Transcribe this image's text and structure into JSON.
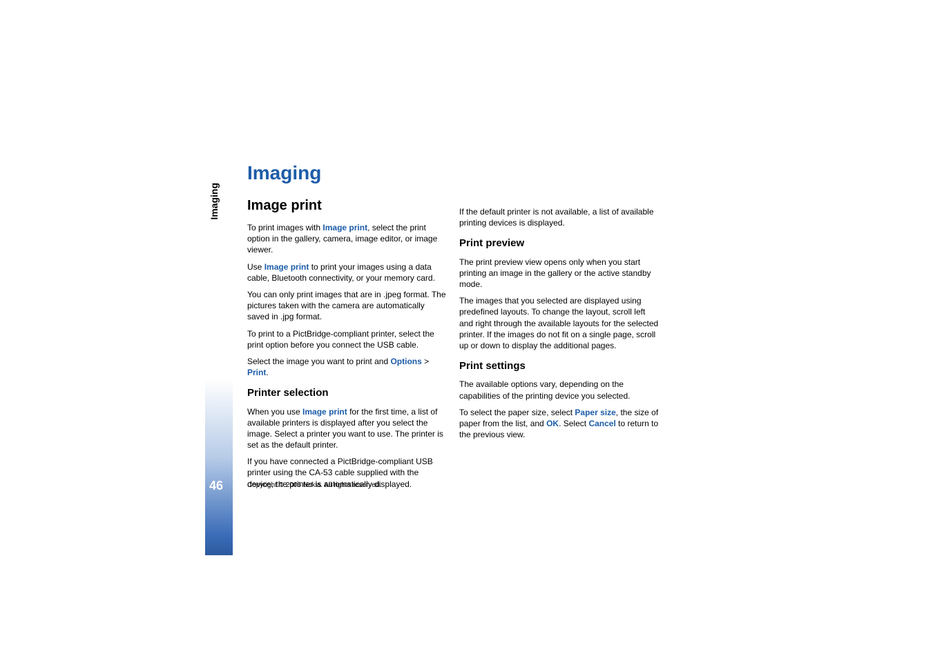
{
  "sidebar": {
    "label": "Imaging",
    "pageNumber": "46"
  },
  "mainTitle": "Imaging",
  "leftColumn": {
    "heading": "Image print",
    "p1_a": "To print images with ",
    "p1_link": "Image print",
    "p1_b": ", select the print option in the gallery, camera, image editor, or image viewer.",
    "p2_a": "Use ",
    "p2_link": "Image print",
    "p2_b": " to print your images using a data cable, Bluetooth connectivity, or your memory card.",
    "p3": "You can only print images that are in .jpeg format. The pictures taken with the camera are automatically saved in .jpg format.",
    "p4": "To print to a PictBridge-compliant printer, select the print option before you connect the USB cable.",
    "p5_a": "Select the image you want to print and ",
    "p5_link1": "Options",
    "p5_mid": " > ",
    "p5_link2": "Print",
    "p5_end": ".",
    "subheading": "Printer selection",
    "p6_a": "When you use ",
    "p6_link": "Image print",
    "p6_b": " for the first time, a list of available printers is displayed after you select the image. Select a printer you want to use. The printer is set as the default printer.",
    "p7": "If you have connected a PictBridge-compliant USB printer using the CA-53 cable supplied with the device, the printer is automatically displayed."
  },
  "rightColumn": {
    "p1": "If the default printer is not available, a list of available printing devices is displayed.",
    "subheading1": "Print preview",
    "p2": "The print preview view opens only when you start printing an image in the gallery or the active standby mode.",
    "p3": "The images that you selected are displayed using predefined layouts. To change the layout, scroll left and right through the available layouts for the selected printer. If the images do not fit on a single page, scroll up or down to display the additional pages.",
    "subheading2": "Print settings",
    "p4": "The available options vary, depending on the capabilities of the printing device you selected.",
    "p5_a": "To select the paper size, select ",
    "p5_link1": "Paper size",
    "p5_b": ", the size of paper from the list, and ",
    "p5_link2": "OK",
    "p5_c": ". Select ",
    "p5_link3": "Cancel",
    "p5_d": " to return to the previous view."
  },
  "copyright": "Copyright © 2006 Nokia. All rights reserved."
}
